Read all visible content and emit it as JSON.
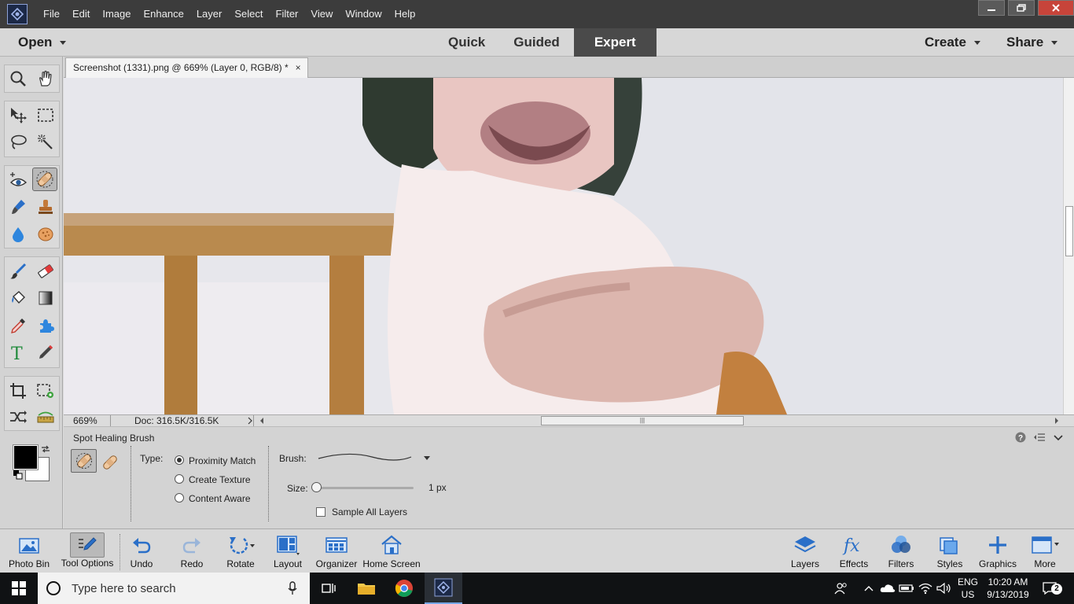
{
  "menubar": {
    "items": [
      "File",
      "Edit",
      "Image",
      "Enhance",
      "Layer",
      "Select",
      "Filter",
      "View",
      "Window",
      "Help"
    ]
  },
  "modebar": {
    "open_label": "Open",
    "tabs": [
      "Quick",
      "Guided",
      "Expert"
    ],
    "active_tab": "Expert",
    "create_label": "Create",
    "share_label": "Share"
  },
  "document": {
    "tab_title": "Screenshot (1331).png @ 669% (Layer 0, RGB/8) *",
    "close_glyph": "×"
  },
  "statusbar": {
    "zoom": "669%",
    "doc_info": "Doc: 316.5K/316.5K"
  },
  "tool_options": {
    "tool_name": "Spot Healing Brush",
    "type_label": "Type:",
    "type_options": [
      "Proximity Match",
      "Create Texture",
      "Content Aware"
    ],
    "selected_type": "Proximity Match",
    "brush_label": "Brush:",
    "size_label": "Size:",
    "size_value": "1 px",
    "size_level": 0,
    "sample_all_layers_label": "Sample All Layers",
    "sample_all_layers_checked": false
  },
  "panelbar": {
    "left": [
      "Photo Bin",
      "Tool Options",
      "Undo",
      "Redo",
      "Rotate",
      "Layout",
      "Organizer",
      "Home Screen"
    ],
    "active": "Tool Options",
    "right": [
      "Layers",
      "Effects",
      "Filters",
      "Styles",
      "Graphics",
      "More"
    ]
  },
  "taskbar": {
    "search_placeholder": "Type here to search",
    "lang_line1": "ENG",
    "lang_line2": "US",
    "time": "10:20 AM",
    "date": "9/13/2019",
    "notification_count": "2"
  },
  "colors": {
    "accent_brand": "#1c2947",
    "close_red": "#c7443a",
    "active_mode_tab": "#4a4a4a",
    "taskbar": "#101214"
  }
}
